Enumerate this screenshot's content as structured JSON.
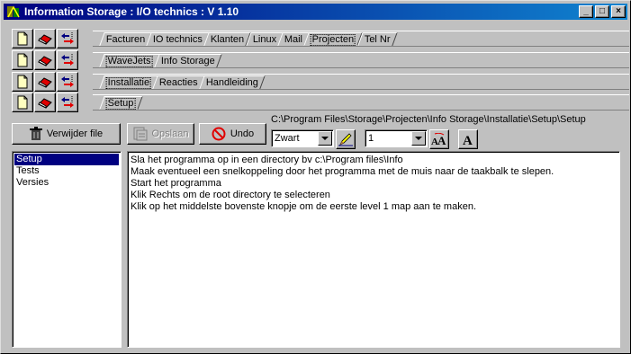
{
  "window": {
    "title": "Information Storage : I/O technics : V 1.10",
    "minimize_label": "_",
    "maximize_label": "□",
    "close_label": "×"
  },
  "tab_rows": [
    {
      "tabs": [
        "Facturen",
        "IO technics",
        "Klanten",
        "Linux",
        "Mail",
        "Projecten",
        "Tel Nr"
      ],
      "active": 5
    },
    {
      "tabs": [
        "WaveJets",
        "Info Storage"
      ],
      "active": 0
    },
    {
      "tabs": [
        "Installatie",
        "Reacties",
        "Handleiding"
      ],
      "active": 0
    },
    {
      "tabs": [
        "Setup"
      ],
      "active": 0
    }
  ],
  "toolbar": {
    "delete_label": "Verwijder file",
    "save_label": "Opslaan",
    "undo_label": "Undo",
    "path": "C:\\Program Files\\Storage\\Projecten\\Info Storage\\Installatie\\Setup\\Setup",
    "color_value": "Zwart",
    "size_value": "1"
  },
  "files": [
    "Setup",
    "Tests",
    "Versies"
  ],
  "selected_file": 0,
  "content_lines": [
    "Sla het programma op in een directory bv c:\\Program files\\Info",
    "Maak eventueel een snelkoppeling door het programma met de muis naar de taakbalk te slepen.",
    "Start het programma",
    "Klik Rechts om de root directory te selecteren",
    "Klik op het middelste bovenste knopje om de eerste level 1 map aan te maken."
  ],
  "colors": {
    "title_start": "#000080",
    "title_end": "#1084d0",
    "selection": "#000080",
    "face": "#c0c0c0"
  }
}
